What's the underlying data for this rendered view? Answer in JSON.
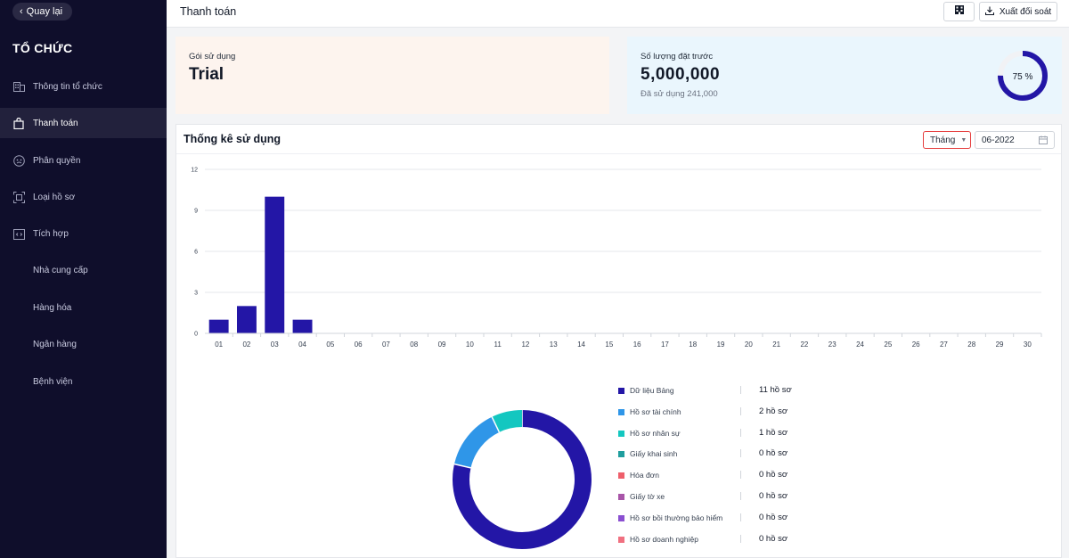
{
  "sidebar": {
    "back_label": "Quay lại",
    "org_title": "TỔ CHỨC",
    "items": [
      {
        "label": "Thông tin tổ chức",
        "icon": "building-icon"
      },
      {
        "label": "Thanh toán",
        "icon": "bag-icon",
        "active": true
      },
      {
        "label": "Phân quyền",
        "icon": "user-circle-icon"
      },
      {
        "label": "Loại hồ sơ",
        "icon": "scan-icon"
      },
      {
        "label": "Tích hợp",
        "icon": "code-icon"
      },
      {
        "label": "Nhà cung cấp"
      },
      {
        "label": "Hàng hóa"
      },
      {
        "label": "Ngân hàng"
      },
      {
        "label": "Bệnh viện"
      }
    ]
  },
  "header": {
    "title": "Thanh toán",
    "export_label": "Xuất đối soát"
  },
  "plan": {
    "label": "Gói sử dụng",
    "value": "Trial"
  },
  "quota": {
    "label": "Số lượng đặt trước",
    "value": "5,000,000",
    "used": "Đã sử dụng 241,000",
    "percent_label": "75 %",
    "percent": 75
  },
  "stats": {
    "title": "Thống kê sử dụng",
    "period": "Tháng",
    "date": "06-2022"
  },
  "colors": {
    "accent": "#2316a6",
    "sidebar_bg": "#0f0e2b"
  },
  "chart_data": [
    {
      "type": "bar",
      "categories": [
        "01",
        "02",
        "03",
        "04",
        "05",
        "06",
        "07",
        "08",
        "09",
        "10",
        "11",
        "12",
        "13",
        "14",
        "15",
        "16",
        "17",
        "18",
        "19",
        "20",
        "21",
        "22",
        "23",
        "24",
        "25",
        "26",
        "27",
        "28",
        "29",
        "30"
      ],
      "values": [
        1,
        2,
        10,
        1,
        0,
        0,
        0,
        0,
        0,
        0,
        0,
        0,
        0,
        0,
        0,
        0,
        0,
        0,
        0,
        0,
        0,
        0,
        0,
        0,
        0,
        0,
        0,
        0,
        0,
        0
      ],
      "yticks": [
        "0",
        "3",
        "6",
        "9",
        "12"
      ],
      "ylim": [
        0,
        12
      ],
      "grid": true,
      "color": "#2316a6"
    },
    {
      "type": "pie",
      "labels": [
        "Dữ liệu Bảng",
        "Hồ sơ tài chính",
        "Hồ sơ nhân sự",
        "Giấy khai sinh",
        "Hóa đơn",
        "Giấy tờ xe",
        "Hồ sơ bồi thường bảo hiểm",
        "Hồ sơ doanh nghiệp"
      ],
      "values": [
        11,
        2,
        1,
        0,
        0,
        0,
        0,
        0
      ],
      "value_labels": [
        "11 hồ sơ",
        "2 hồ sơ",
        "1 hồ sơ",
        "0 hồ sơ",
        "0 hồ sơ",
        "0 hồ sơ",
        "0 hồ sơ",
        "0 hồ sơ"
      ],
      "colors": [
        "#2316a6",
        "#2f96e8",
        "#13c7c0",
        "#1f9e9e",
        "#ee5f6b",
        "#a855a8",
        "#8a4fd1",
        "#f07080"
      ]
    }
  ]
}
